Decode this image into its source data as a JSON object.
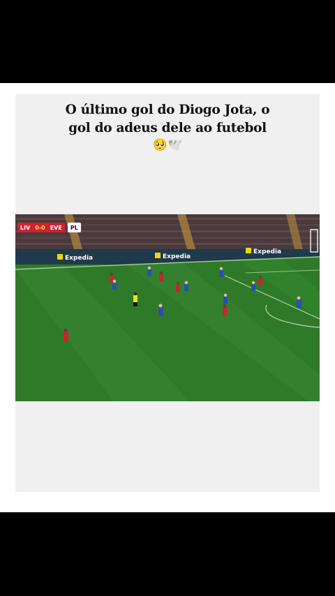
{
  "post": {
    "caption_line1": "O último gol do Diogo Jota, o",
    "caption_line2": "gol do adeus dele ao futebol",
    "emojis": "🥺🕊️"
  },
  "video": {
    "scoreboard": {
      "home": "LIV",
      "score": "0-0",
      "away": "EVE",
      "league": "PL"
    },
    "ad_boards": [
      "Expedia",
      "Expedia",
      "Expedia"
    ]
  },
  "colors": {
    "pitch": "#2f7a28",
    "home_kit": "#c8262a",
    "away_kit": "#2a4fb0",
    "scorebug": "#d2202f"
  }
}
